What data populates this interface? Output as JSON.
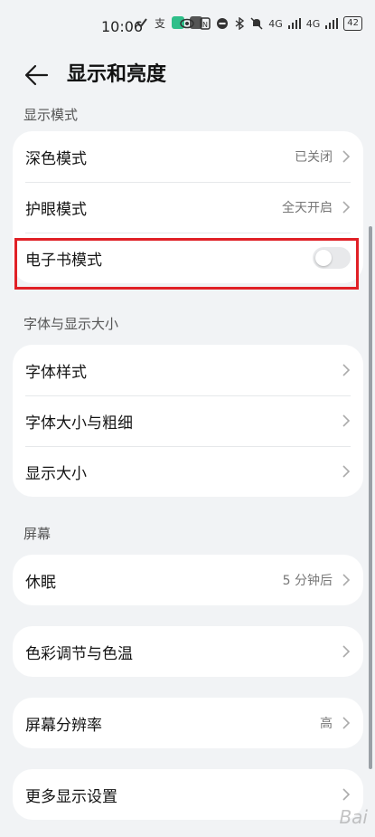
{
  "status_bar": {
    "time": "10:06",
    "network1": "4G",
    "network2": "4G",
    "battery": "42"
  },
  "header": {
    "title": "显示和亮度"
  },
  "sections": {
    "display_mode": {
      "title": "显示模式",
      "dark_mode": {
        "label": "深色模式",
        "value": "已关闭"
      },
      "eye_comfort": {
        "label": "护眼模式",
        "value": "全天开启"
      },
      "ebook_mode": {
        "label": "电子书模式",
        "enabled": false
      }
    },
    "font_display": {
      "title": "字体与显示大小",
      "font_style": {
        "label": "字体样式"
      },
      "font_size": {
        "label": "字体大小与粗细"
      },
      "display_size": {
        "label": "显示大小"
      }
    },
    "screen": {
      "title": "屏幕",
      "sleep": {
        "label": "休眠",
        "value": "5 分钟后"
      },
      "color": {
        "label": "色彩调节与色温"
      },
      "resolution": {
        "label": "屏幕分辨率",
        "value": "高"
      },
      "more": {
        "label": "更多显示设置"
      }
    }
  },
  "colors": {
    "background": "#f1f3f5",
    "card": "#ffffff",
    "highlight": "#e02026"
  }
}
